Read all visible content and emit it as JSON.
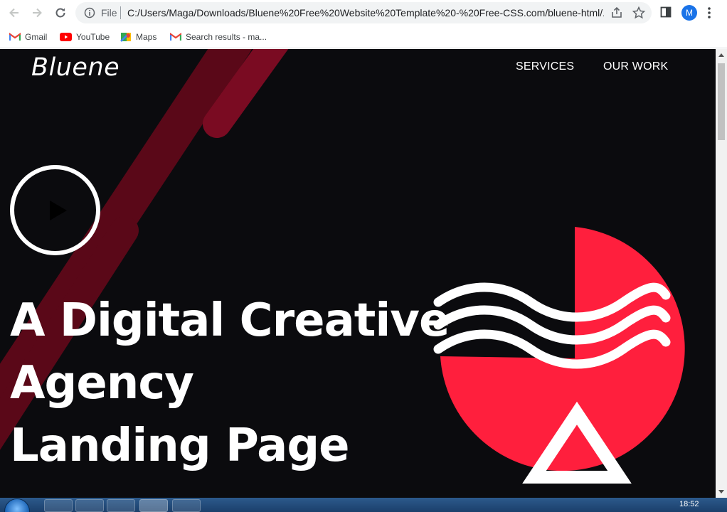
{
  "browser": {
    "file_label": "File",
    "url": "C:/Users/Maga/Downloads/Bluene%20Free%20Website%20Template%20-%20Free-CSS.com/bluene-html/...",
    "profile_initial": "M"
  },
  "bookmarks": [
    {
      "label": "Gmail",
      "icon": "gmail-icon"
    },
    {
      "label": "YouTube",
      "icon": "youtube-icon"
    },
    {
      "label": "Maps",
      "icon": "maps-icon"
    },
    {
      "label": "Search results - ma...",
      "icon": "gmail-icon"
    }
  ],
  "site": {
    "logo": "Bluene",
    "nav": [
      "SERVICES",
      "OUR WORK"
    ],
    "hero": {
      "line1": "A Digital Creative",
      "line2": "Agency",
      "line3": "Landing Page"
    }
  },
  "colors": {
    "background": "#0b0b0e",
    "accent_red": "#ff1f3d",
    "stripe_red": "#6b0a1e"
  },
  "taskbar": {
    "clock": "18:52"
  }
}
